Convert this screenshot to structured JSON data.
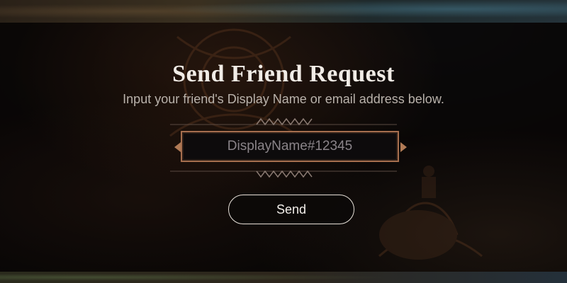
{
  "dialog": {
    "title": "Send Friend Request",
    "subtitle": "Input your friend's Display Name or email address below.",
    "input": {
      "value": "",
      "placeholder": "DisplayName#12345"
    },
    "send_label": "Send"
  },
  "colors": {
    "title": "#f1ece6",
    "subtitle": "#b9b2ab",
    "field_border": "#a56e4e",
    "placeholder": "#8a8489",
    "button_border": "#e8e2da"
  },
  "icons": [
    "ornament-divider-icon",
    "field-frame-tip-icon"
  ]
}
